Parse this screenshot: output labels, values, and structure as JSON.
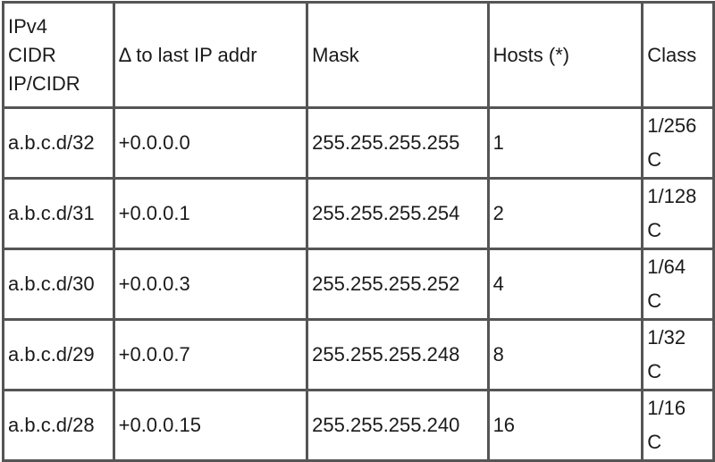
{
  "table": {
    "headers": [
      "IPv4 CIDR IP/CIDR",
      "Δ to last IP addr",
      "Mask",
      "Hosts (*)",
      "Class"
    ],
    "header_lines": {
      "col0": [
        "IPv4",
        "CIDR",
        "IP/CIDR"
      ]
    },
    "rows": [
      {
        "cidr": "a.b.c.d/32",
        "delta": "+0.0.0.0",
        "mask": "255.255.255.255",
        "hosts": "1",
        "class_frac": "1/256",
        "class_letter": "C"
      },
      {
        "cidr": "a.b.c.d/31",
        "delta": "+0.0.0.1",
        "mask": "255.255.255.254",
        "hosts": "2",
        "class_frac": "1/128",
        "class_letter": "C"
      },
      {
        "cidr": "a.b.c.d/30",
        "delta": "+0.0.0.3",
        "mask": "255.255.255.252",
        "hosts": "4",
        "class_frac": "1/64",
        "class_letter": "C"
      },
      {
        "cidr": "a.b.c.d/29",
        "delta": "+0.0.0.7",
        "mask": "255.255.255.248",
        "hosts": "8",
        "class_frac": "1/32",
        "class_letter": "C"
      },
      {
        "cidr": "a.b.c.d/28",
        "delta": "+0.0.0.15",
        "mask": "255.255.255.240",
        "hosts": "16",
        "class_frac": "1/16",
        "class_letter": "C"
      }
    ]
  }
}
